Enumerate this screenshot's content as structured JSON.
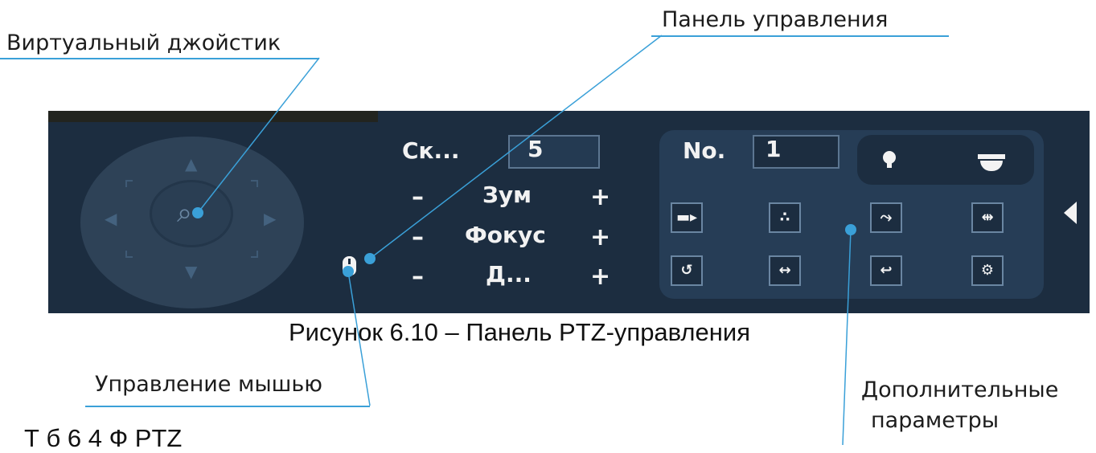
{
  "callouts": {
    "joystick": "Виртуальный джойстик",
    "control_panel": "Панель управления",
    "mouse_control": "Управление мышью",
    "extra_params_line1": "Дополнительные",
    "extra_params_line2": "параметры"
  },
  "caption": "Рисунок 6.10 – Панель PTZ-управления",
  "cut_heading": "Т б          6 4    Ф                                       PTZ",
  "ptz": {
    "speed_label": "Ск...",
    "speed_value": "5",
    "zoom_label": "Зум",
    "focus_label": "Фокус",
    "iris_label": "Д...",
    "minus": "–",
    "plus": "+",
    "no_label": "No.",
    "no_value": "1"
  },
  "icons": {
    "joystick": "joystick-icon",
    "mouse": "mouse-icon",
    "light": "light-bulb-icon",
    "wiper": "dome-camera-icon",
    "preset": "camera-icon",
    "tour": "tour-icon",
    "pattern": "pattern-icon",
    "border": "border-scan-icon",
    "rotate": "rotate-icon",
    "pan": "pan-icon",
    "flip": "flip-icon",
    "settings": "gear-icon",
    "collapse": "collapse-arrow-icon"
  },
  "colors": {
    "panel_bg": "#1c2d40",
    "accent_line": "#3aa0d8",
    "text": "#f2f2f2"
  }
}
